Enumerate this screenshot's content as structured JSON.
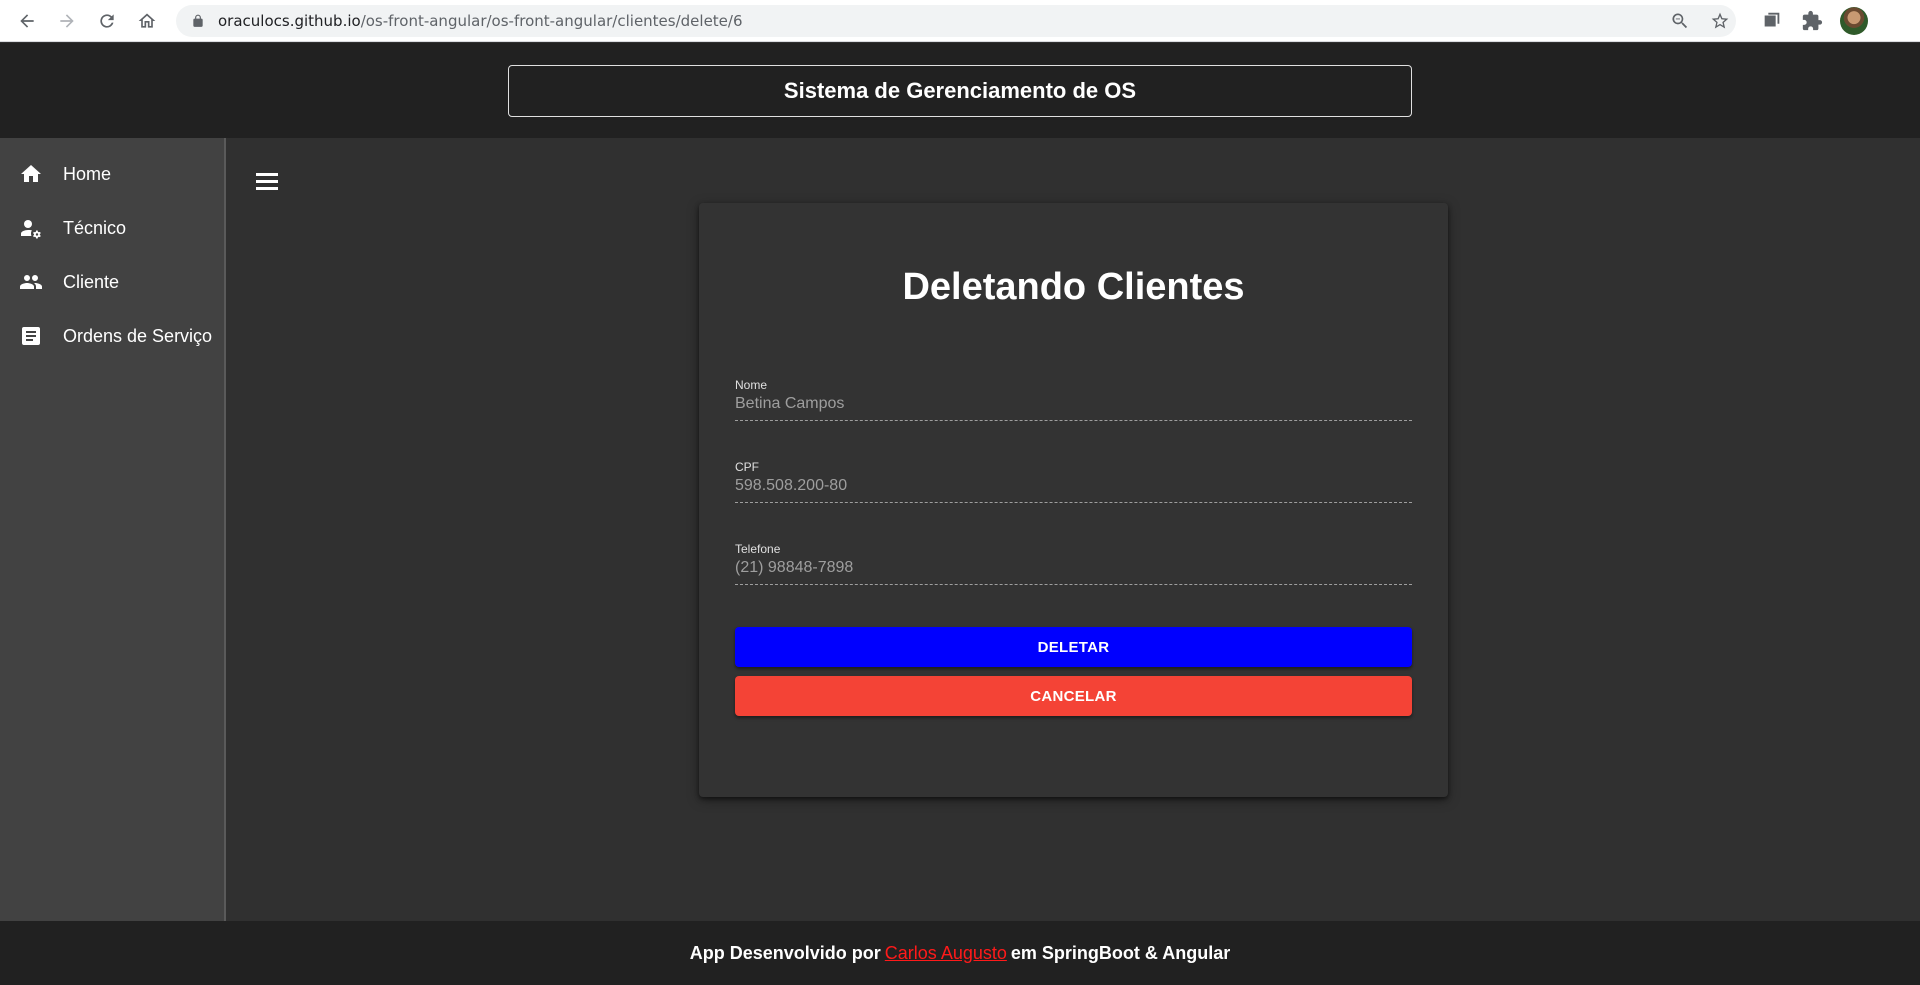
{
  "browser": {
    "url_host": "oraculocs.github.io",
    "url_path": "/os-front-angular/os-front-angular/clientes/delete/6"
  },
  "header": {
    "title": "Sistema de Gerenciamento de OS"
  },
  "sidebar": {
    "items": [
      {
        "label": "Home",
        "icon": "home-icon"
      },
      {
        "label": "Técnico",
        "icon": "engineer-icon"
      },
      {
        "label": "Cliente",
        "icon": "people-icon"
      },
      {
        "label": "Ordens de Serviço",
        "icon": "document-icon"
      }
    ]
  },
  "card": {
    "title": "Deletando Clientes",
    "fields": [
      {
        "label": "Nome",
        "value": "Betina Campos"
      },
      {
        "label": "CPF",
        "value": "598.508.200-80"
      },
      {
        "label": "Telefone",
        "value": "(21) 98848-7898"
      }
    ],
    "delete_label": "DELETAR",
    "cancel_label": "CANCELAR"
  },
  "footer": {
    "prefix": "App Desenvolvido por",
    "author": "Carlos Augusto",
    "suffix": "em SpringBoot & Angular"
  },
  "colors": {
    "delete_button": "#0000ff",
    "cancel_button": "#f44336",
    "footer_link": "#ff1a1a",
    "background": "#303030",
    "header": "#212121",
    "sidebar": "#424242"
  }
}
